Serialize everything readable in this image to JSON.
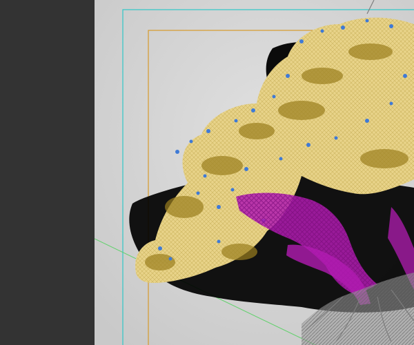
{
  "colors": {
    "panel": "#333333",
    "viewport_bg": "#d4d4d4",
    "safe_frame_cyan": "#2fc7c7",
    "render_frame_orange": "#d79a2a",
    "grid_axis_green": "#5fd16a",
    "foliage_yellow": "#e8d389",
    "foliage_dark": "#9b7f1e",
    "leaf_blue": "#3f7ad6",
    "trunk_magenta": "#b21cb2",
    "roots_gray": "#8a8a8a",
    "shadow": "#000000"
  },
  "icons": {
    "tree": "tree-wireframe-icon"
  }
}
